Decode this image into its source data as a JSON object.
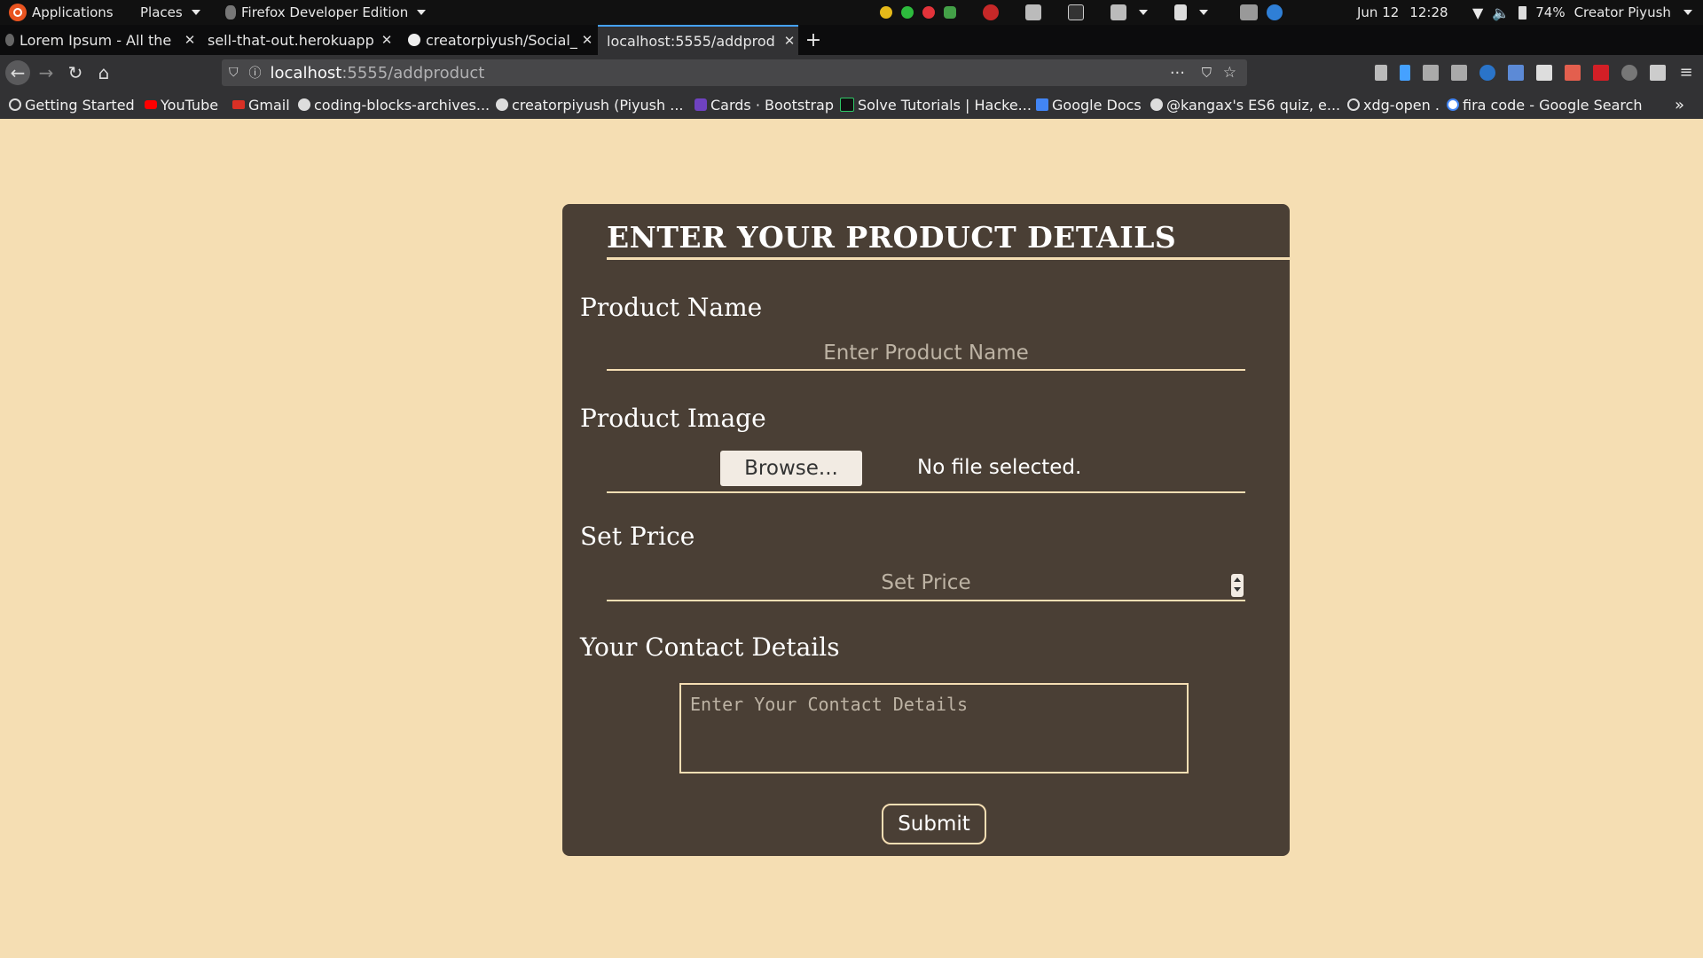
{
  "panel": {
    "applications": "Applications",
    "places": "Places",
    "active_app": "Firefox Developer Edition",
    "date": "Jun 12",
    "time": "12:28",
    "battery": "74%",
    "user": "Creator Piyush"
  },
  "tabs": [
    {
      "label": "Lorem Ipsum - All the"
    },
    {
      "label": "sell-that-out.herokuapp"
    },
    {
      "label": "creatorpiyush/Social_"
    },
    {
      "label": "localhost:5555/addprod"
    }
  ],
  "urlbar": {
    "host": "localhost",
    "path": ":5555/addproduct"
  },
  "bookmarks": [
    "Getting Started",
    "YouTube",
    "Gmail",
    "coding-blocks-archives...",
    "creatorpiyush (Piyush ...",
    "Cards · Bootstrap",
    "Solve Tutorials | Hacke...",
    "Google Docs",
    "@kangax's ES6 quiz, e...",
    "xdg-open .",
    "fira code - Google Search"
  ],
  "form": {
    "title": "ENTER YOUR PRODUCT DETAILS",
    "product_name_label": "Product Name",
    "product_name_placeholder": "Enter Product Name",
    "product_image_label": "Product Image",
    "browse_label": "Browse...",
    "no_file_text": "No file selected.",
    "price_label": "Set Price",
    "price_placeholder": "Set Price",
    "contact_label": "Your Contact Details",
    "contact_placeholder": "Enter Your Contact Details",
    "submit_label": "Submit"
  }
}
